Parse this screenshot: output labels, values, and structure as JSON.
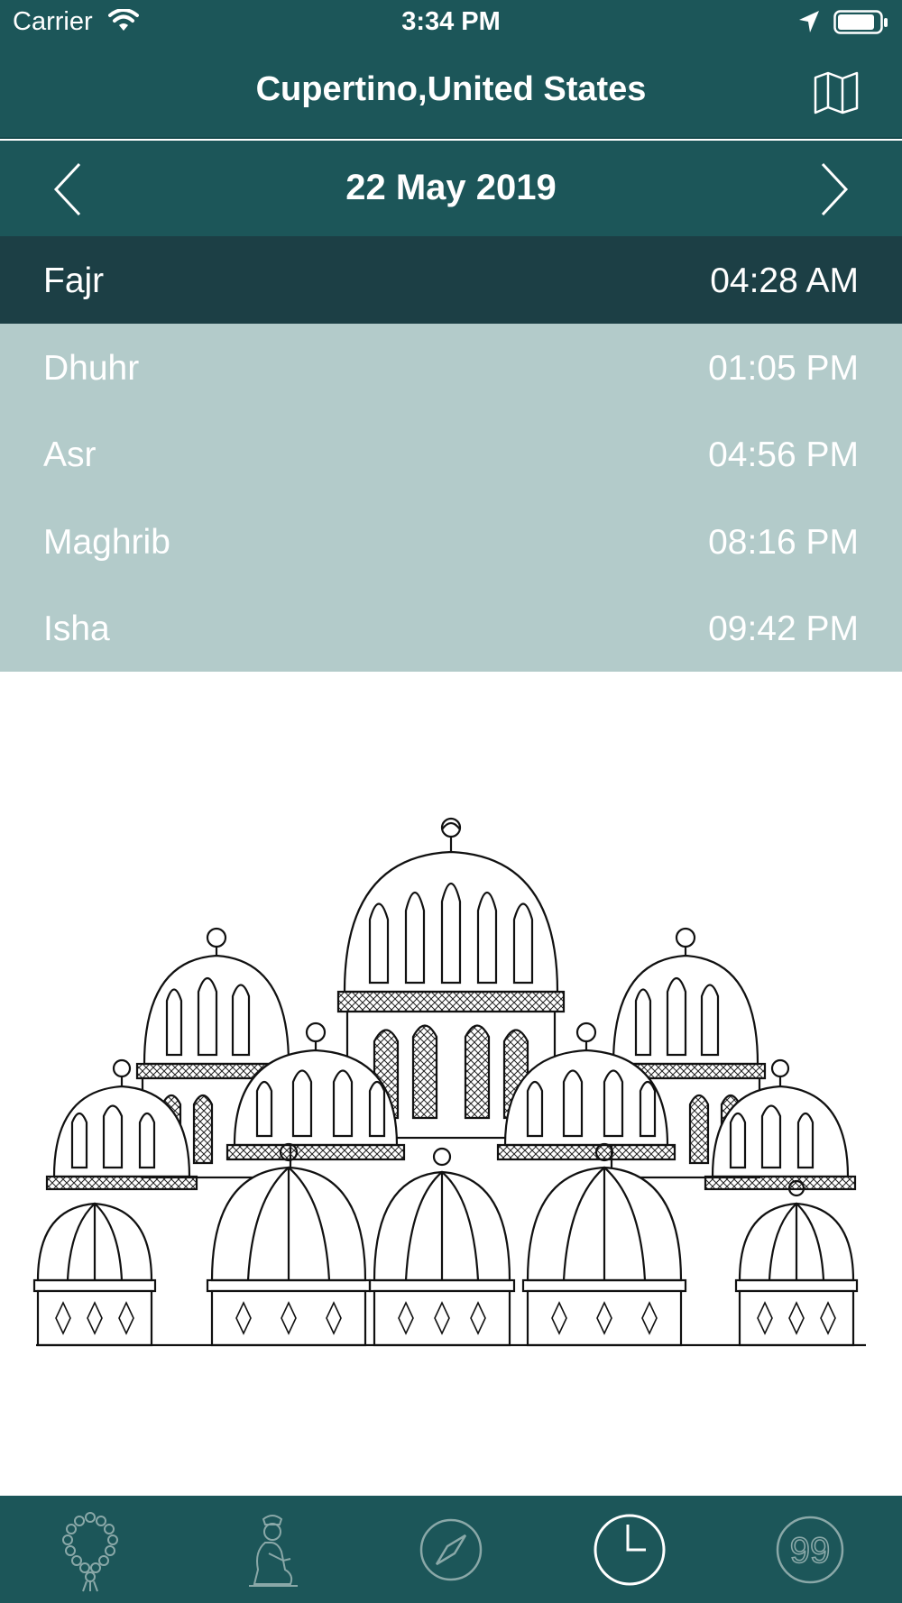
{
  "status": {
    "carrier": "Carrier",
    "time": "3:34 PM"
  },
  "header": {
    "title": "Cupertino,United States",
    "map_icon": "map-icon"
  },
  "date_nav": {
    "date": "22 May 2019",
    "prev_icon": "chevron-left-icon",
    "next_icon": "chevron-right-icon"
  },
  "prayers": [
    {
      "name": "Fajr",
      "time": "04:28 AM",
      "active": true
    },
    {
      "name": "Dhuhr",
      "time": "01:05 PM",
      "active": false
    },
    {
      "name": "Asr",
      "time": "04:56 PM",
      "active": false
    },
    {
      "name": "Maghrib",
      "time": "08:16 PM",
      "active": false
    },
    {
      "name": "Isha",
      "time": "09:42 PM",
      "active": false
    }
  ],
  "tabs": [
    {
      "icon": "prayer-beads-icon",
      "selected": false
    },
    {
      "icon": "praying-person-icon",
      "selected": false
    },
    {
      "icon": "compass-icon",
      "selected": false
    },
    {
      "icon": "clock-icon",
      "selected": true
    },
    {
      "icon": "names-99-icon",
      "label": "99",
      "selected": false
    }
  ],
  "colors": {
    "primary": "#1c5659",
    "active_row": "#1c3f45",
    "row": "#b3cbca"
  }
}
